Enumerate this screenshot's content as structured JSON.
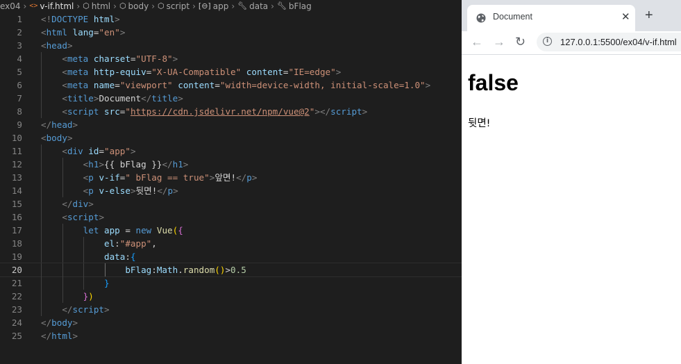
{
  "breadcrumb": {
    "folder": "ex04",
    "file": "v-if.html",
    "path": [
      "html",
      "body",
      "script",
      "app",
      "data",
      "bFlag"
    ]
  },
  "code_lines": [
    "1",
    "2",
    "3",
    "4",
    "5",
    "6",
    "7",
    "8",
    "9",
    "10",
    "11",
    "12",
    "13",
    "14",
    "15",
    "16",
    "17",
    "18",
    "19",
    "20",
    "21",
    "22",
    "23",
    "24",
    "25"
  ],
  "code": {
    "l1": {
      "open": "<!",
      "tag": "DOCTYPE",
      "rest": " html",
      "close": ">"
    },
    "l2": {
      "tag": "html",
      "attr": "lang",
      "val": "\"en\""
    },
    "l3": {
      "tag": "head"
    },
    "l4": {
      "tag": "meta",
      "attr": "charset",
      "val": "\"UTF-8\""
    },
    "l5": {
      "tag": "meta",
      "attr1": "http-equiv",
      "val1": "\"X-UA-Compatible\"",
      "attr2": "content",
      "val2": "\"IE=edge\""
    },
    "l6": {
      "tag": "meta",
      "attr1": "name",
      "val1": "\"viewport\"",
      "attr2": "content",
      "val2": "\"width=device-width, initial-scale=1.0\""
    },
    "l7": {
      "tag": "title",
      "text": "Document"
    },
    "l8": {
      "tag": "script",
      "attr": "src",
      "q": "\"",
      "url": "https://cdn.jsdelivr.net/npm/vue@2"
    },
    "l9": {
      "tag": "head"
    },
    "l10": {
      "tag": "body"
    },
    "l11": {
      "tag": "div",
      "attr": "id",
      "val": "\"app\""
    },
    "l12": {
      "tag": "h1",
      "text": "{{ bFlag }}"
    },
    "l13": {
      "tag": "p",
      "attr": "v-if",
      "val": "\" bFlag == true\"",
      "text": "앞면!"
    },
    "l14": {
      "tag": "p",
      "attr": "v-else",
      "text": "뒷면!"
    },
    "l15": {
      "tag": "div"
    },
    "l16": {
      "tag": "script"
    },
    "l17": {
      "kw1": "let",
      "var": "app",
      "eq": " = ",
      "kw2": "new",
      "fn": "Vue",
      "p": "(",
      "b": "{"
    },
    "l18": {
      "key": "el",
      "colon": ":",
      "str": "\"#app\"",
      "comma": ","
    },
    "l19": {
      "key": "data",
      "colon": ":",
      "b": "{"
    },
    "l20": {
      "key": "bFlag",
      "colon": ":",
      "obj": "Math",
      "dot": ".",
      "fn": "random",
      "p": "()",
      "op": ">",
      "num": "0.5"
    },
    "l21": {
      "b": "}"
    },
    "l22": {
      "b": "}",
      "p": ")"
    },
    "l23": {
      "tag": "script"
    },
    "l24": {
      "tag": "body"
    },
    "l25": {
      "tag": "html"
    }
  },
  "browser": {
    "tab_title": "Document",
    "close_glyph": "✕",
    "new_tab_glyph": "+",
    "back_glyph": "←",
    "forward_glyph": "→",
    "reload_glyph": "↻",
    "info_glyph": "i",
    "url": "127.0.0.1:5500/ex04/v-if.html",
    "page_heading": "false",
    "page_paragraph": "뒷면!"
  },
  "colors": {
    "editor_bg": "#1e1e1e",
    "tag": "#569cd6",
    "attr": "#9cdcfe",
    "string": "#ce9178",
    "function": "#dcdcaa",
    "number": "#b5cea8"
  }
}
